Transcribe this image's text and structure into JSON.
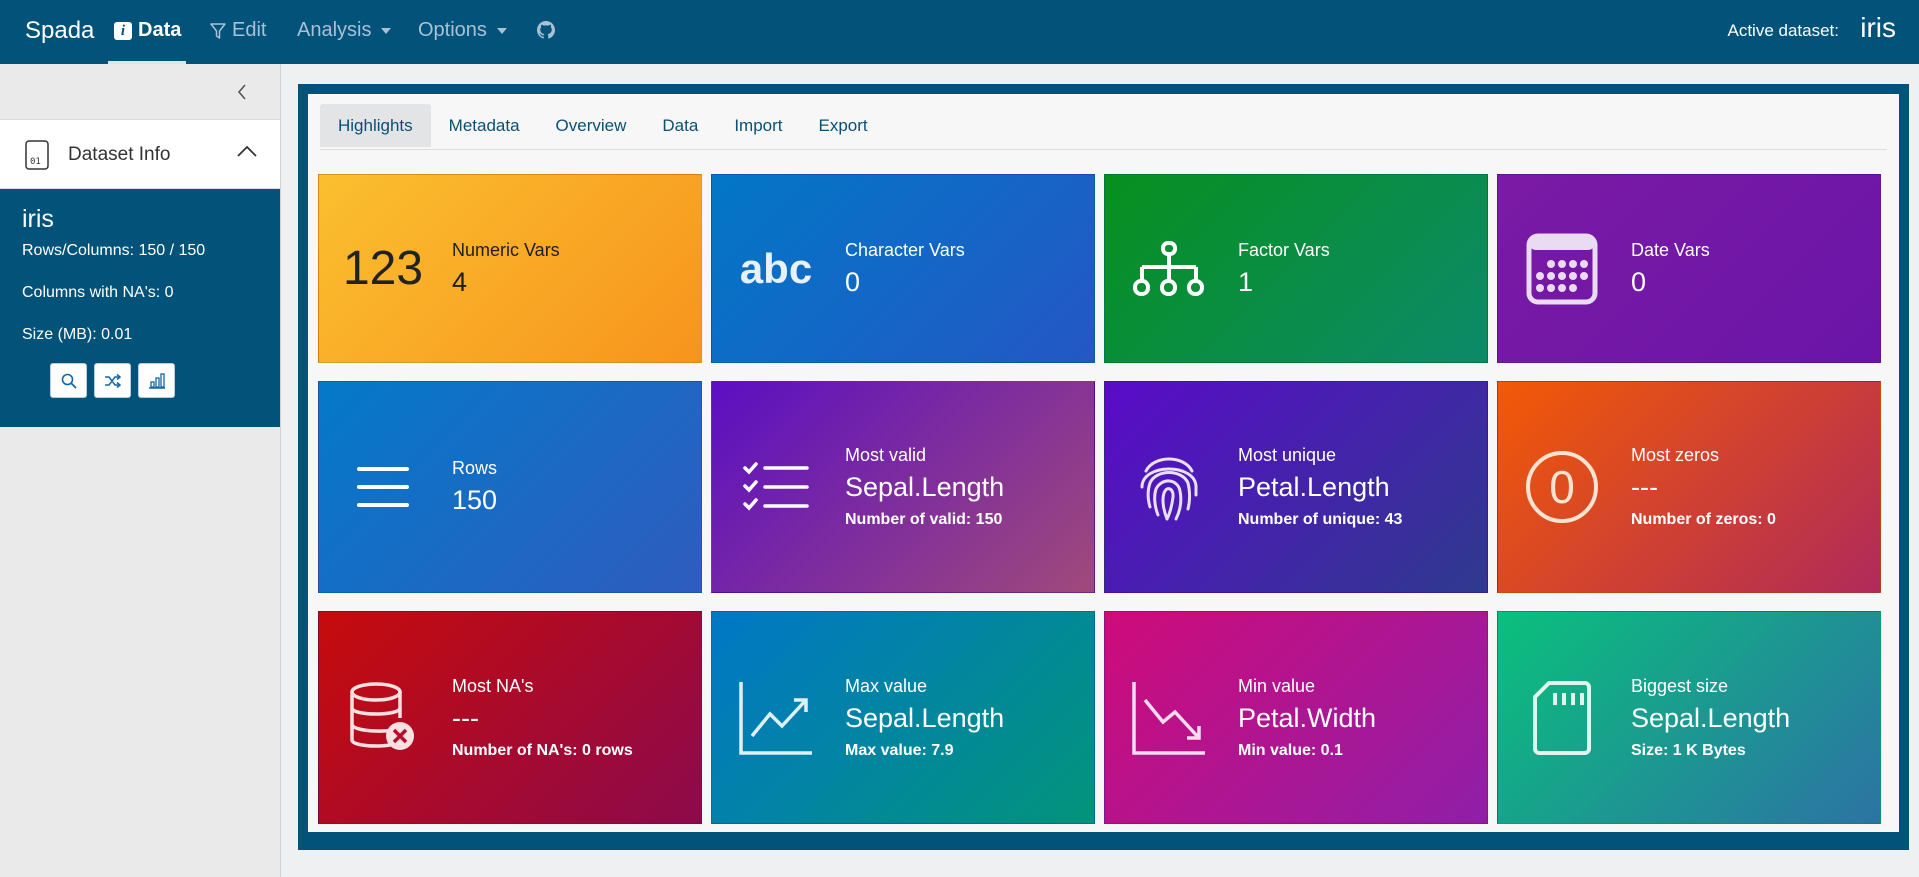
{
  "nav": {
    "brand": "Spada",
    "data_label": "Data",
    "edit_label": "Edit",
    "analysis_label": "Analysis",
    "options_label": "Options",
    "active_label": "Active dataset:",
    "active_name": "iris"
  },
  "sidebar": {
    "section_title": "Dataset Info",
    "dataset_name": "iris",
    "rows_cols": "Rows/Columns: 150 / 150",
    "na_cols": "Columns with NA's: 0",
    "size": "Size (MB): 0.01"
  },
  "tabs": [
    {
      "label": "Highlights"
    },
    {
      "label": "Metadata"
    },
    {
      "label": "Overview"
    },
    {
      "label": "Data"
    },
    {
      "label": "Import"
    },
    {
      "label": "Export"
    }
  ],
  "cards": {
    "numeric": {
      "icon_text": "123",
      "title": "Numeric Vars",
      "value": "4"
    },
    "character": {
      "icon_text": "abc",
      "title": "Character Vars",
      "value": "0"
    },
    "factor": {
      "title": "Factor Vars",
      "value": "1"
    },
    "date": {
      "title": "Date Vars",
      "value": "0"
    },
    "rows": {
      "title": "Rows",
      "value": "150"
    },
    "valid": {
      "title": "Most valid",
      "value": "Sepal.Length",
      "sub": "Number of valid: 150"
    },
    "unique": {
      "title": "Most unique",
      "value": "Petal.Length",
      "sub": "Number of unique: 43"
    },
    "zeros": {
      "icon_text": "0",
      "title": "Most zeros",
      "value": "---",
      "sub": "Number of zeros: 0"
    },
    "na": {
      "title": "Most NA's",
      "value": "---",
      "sub": "Number of NA's: 0 rows"
    },
    "max": {
      "title": "Max value",
      "value": "Sepal.Length",
      "sub": "Max value: 7.9"
    },
    "min": {
      "title": "Min value",
      "value": "Petal.Width",
      "sub": "Min value: 0.1"
    },
    "size": {
      "title": "Biggest size",
      "value": "Sepal.Length",
      "sub": "Size: 1 K Bytes"
    }
  },
  "colors": {
    "navbar": "#02527a",
    "numeric": [
      "#fbbf2f",
      "#f7941d"
    ],
    "character": [
      "#0277c6",
      "#2457c5"
    ],
    "factor": [
      "#07901e",
      "#0c8a6a"
    ],
    "date": [
      "#7b1aa5",
      "#6a15a8"
    ],
    "rows": [
      "#0479c8",
      "#2f5cbf"
    ],
    "valid": [
      "#5b0fc2",
      "#a04a7a"
    ],
    "unique": [
      "#5a0bc8",
      "#2e3a8e"
    ],
    "zeros": [
      "#f25a05",
      "#b02a5a"
    ],
    "na": [
      "#c70b0b",
      "#8c0a4c"
    ],
    "max": [
      "#0177c6",
      "#03947a"
    ],
    "min": [
      "#cf0b7a",
      "#8f1fa8"
    ],
    "biggest": [
      "#0ac07c",
      "#2c73a4"
    ]
  }
}
